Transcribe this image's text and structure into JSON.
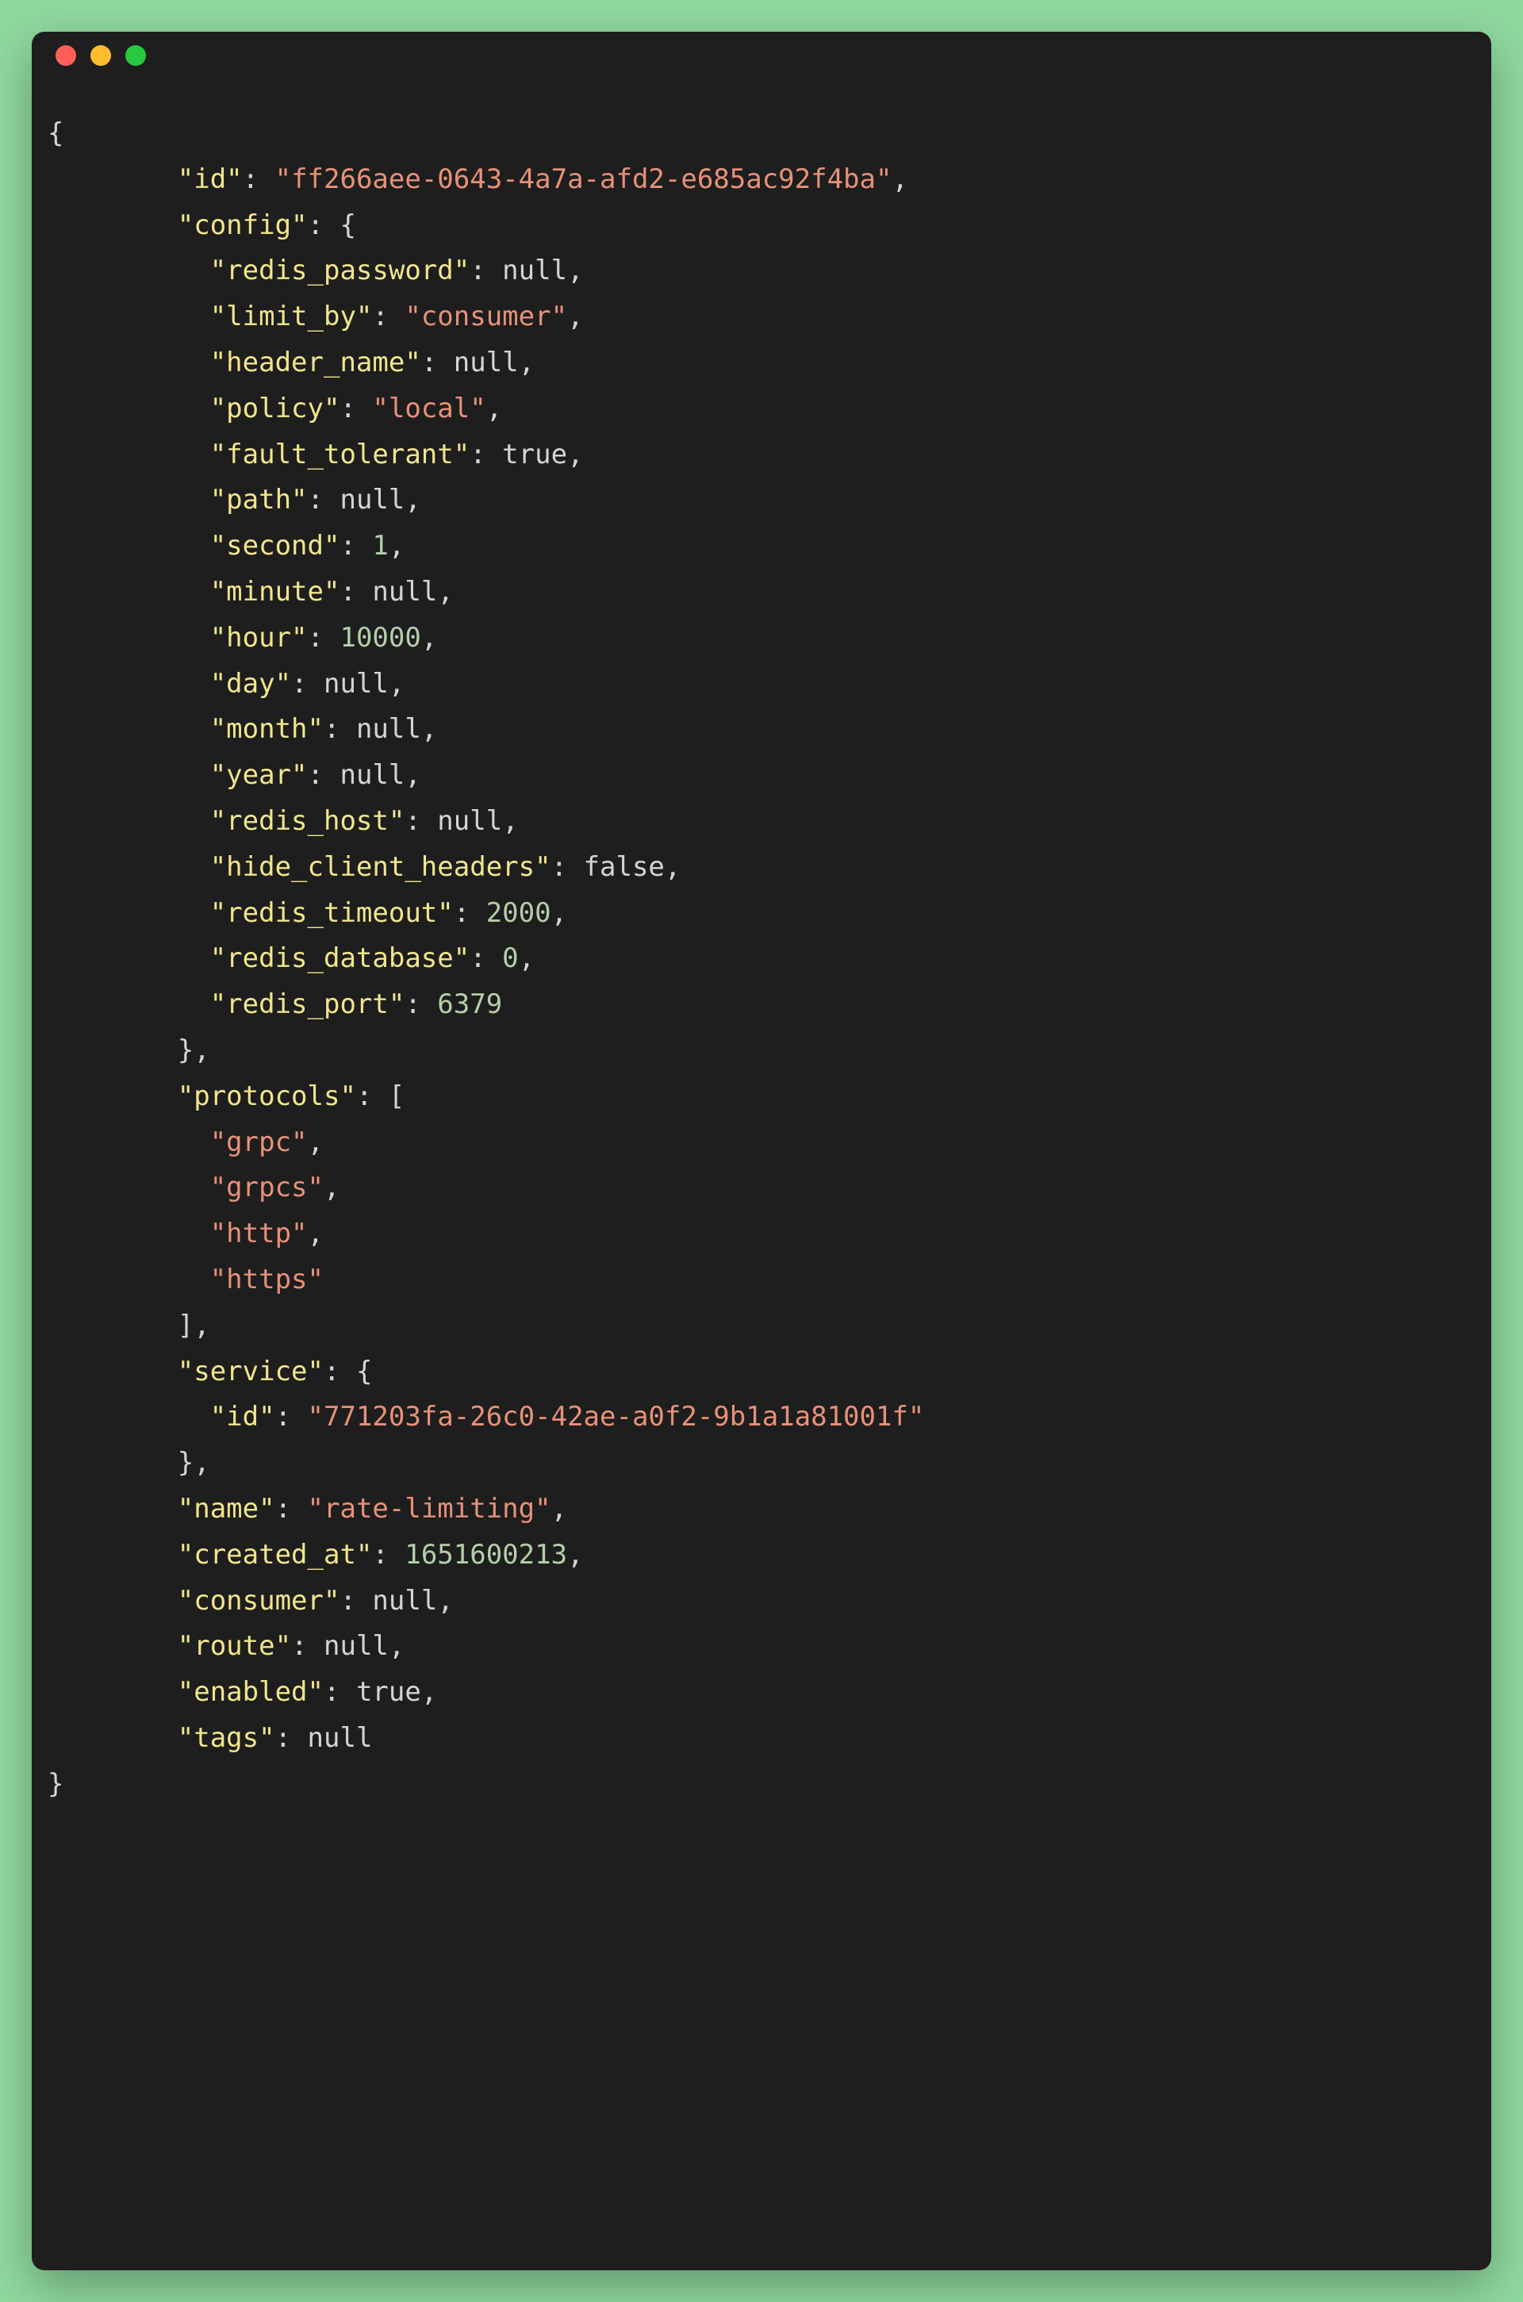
{
  "code": {
    "id_key": "\"id\"",
    "id_val": "\"ff266aee-0643-4a7a-afd2-e685ac92f4ba\"",
    "config_key": "\"config\"",
    "config": {
      "redis_password_key": "\"redis_password\"",
      "redis_password_val": "null",
      "limit_by_key": "\"limit_by\"",
      "limit_by_val": "\"consumer\"",
      "header_name_key": "\"header_name\"",
      "header_name_val": "null",
      "policy_key": "\"policy\"",
      "policy_val": "\"local\"",
      "fault_tolerant_key": "\"fault_tolerant\"",
      "fault_tolerant_val": "true",
      "path_key": "\"path\"",
      "path_val": "null",
      "second_key": "\"second\"",
      "second_val": "1",
      "minute_key": "\"minute\"",
      "minute_val": "null",
      "hour_key": "\"hour\"",
      "hour_val": "10000",
      "day_key": "\"day\"",
      "day_val": "null",
      "month_key": "\"month\"",
      "month_val": "null",
      "year_key": "\"year\"",
      "year_val": "null",
      "redis_host_key": "\"redis_host\"",
      "redis_host_val": "null",
      "hide_client_headers_key": "\"hide_client_headers\"",
      "hide_client_headers_val": "false",
      "redis_timeout_key": "\"redis_timeout\"",
      "redis_timeout_val": "2000",
      "redis_database_key": "\"redis_database\"",
      "redis_database_val": "0",
      "redis_port_key": "\"redis_port\"",
      "redis_port_val": "6379"
    },
    "protocols_key": "\"protocols\"",
    "protocols": {
      "p0": "\"grpc\"",
      "p1": "\"grpcs\"",
      "p2": "\"http\"",
      "p3": "\"https\""
    },
    "service_key": "\"service\"",
    "service": {
      "id_key": "\"id\"",
      "id_val": "\"771203fa-26c0-42ae-a0f2-9b1a1a81001f\""
    },
    "name_key": "\"name\"",
    "name_val": "\"rate-limiting\"",
    "created_at_key": "\"created_at\"",
    "created_at_val": "1651600213",
    "consumer_key": "\"consumer\"",
    "consumer_val": "null",
    "route_key": "\"route\"",
    "route_val": "null",
    "enabled_key": "\"enabled\"",
    "enabled_val": "true",
    "tags_key": "\"tags\"",
    "tags_val": "null"
  },
  "punct": {
    "open_brace": "{",
    "close_brace": "}",
    "open_bracket": "[",
    "close_bracket": "]",
    "colon_space": ": ",
    "comma": ","
  }
}
